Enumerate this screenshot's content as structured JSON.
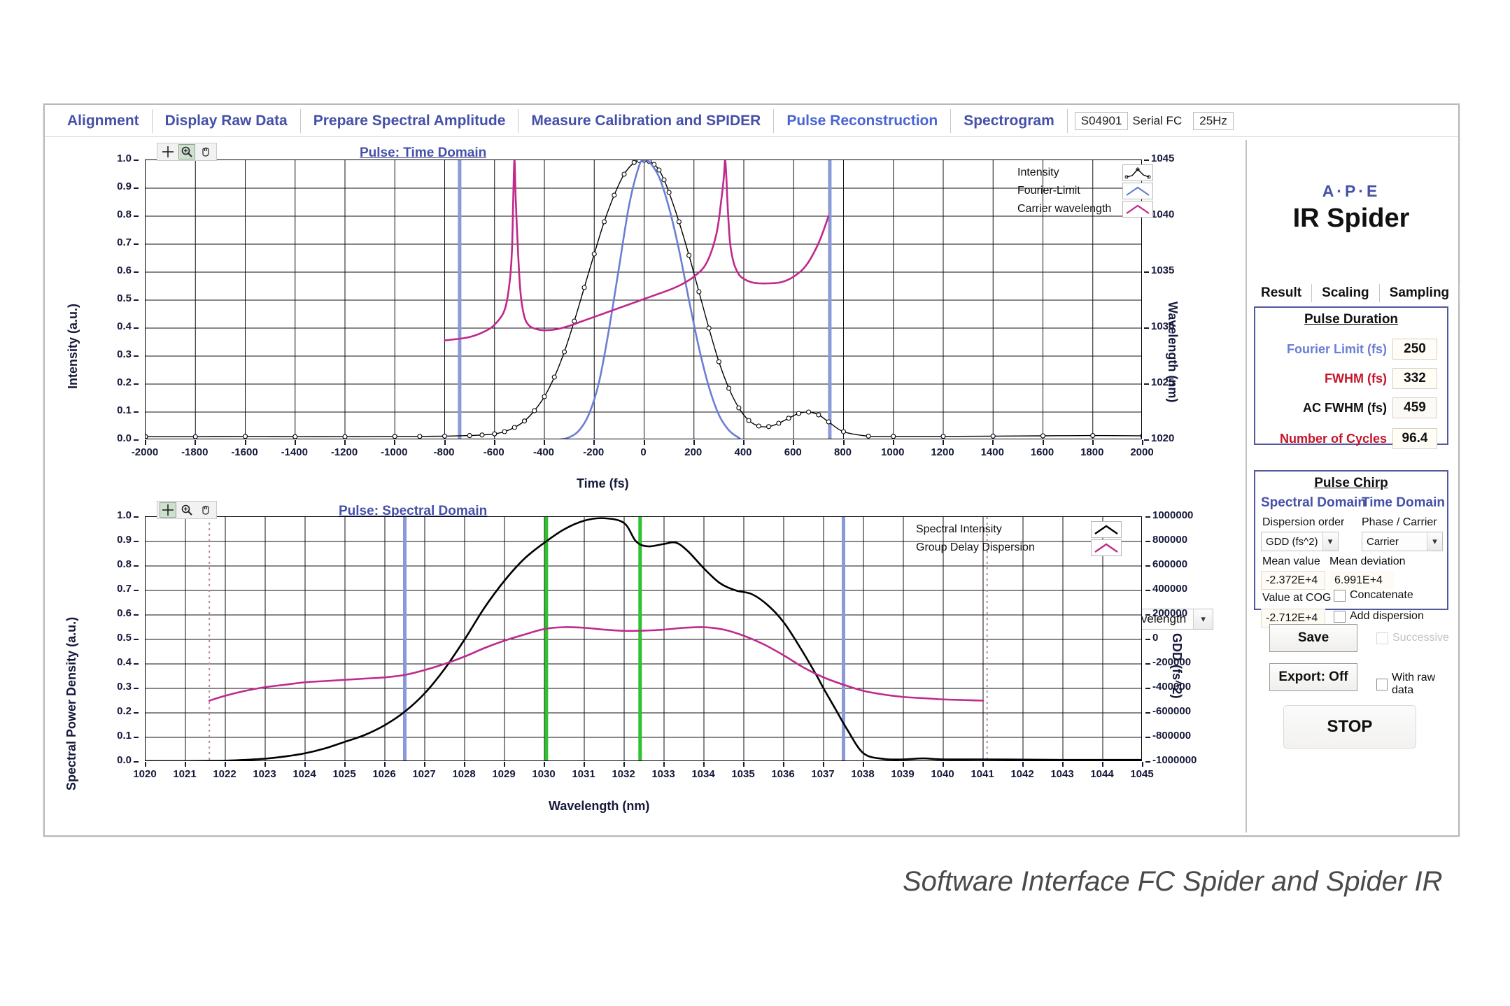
{
  "window": {
    "tabs": [
      {
        "label": "Alignment",
        "active": false
      },
      {
        "label": "Display Raw Data",
        "active": false
      },
      {
        "label": "Prepare Spectral Amplitude",
        "active": false
      },
      {
        "label": "Measure Calibration and SPIDER",
        "active": false
      },
      {
        "label": "Pulse Reconstruction",
        "active": true
      },
      {
        "label": "Spectrogram",
        "active": false
      }
    ],
    "serial_id": "S04901",
    "serial_label": "Serial FC",
    "rep_rate": "25Hz"
  },
  "top_plot": {
    "title": "Pulse: Time Domain",
    "xlabel": "Time (fs)",
    "ylabel": "Intensity (a.u.)",
    "y2label": "Wavelength (nm)",
    "legend": [
      {
        "label": "Intensity",
        "color": "#000000"
      },
      {
        "label": "Fourier-Limit",
        "color": "#6a7fd4"
      },
      {
        "label": "Carrier wavelength",
        "color": "#c0288c"
      }
    ],
    "toolbar": [
      "crosshair-tool",
      "zoom-tool",
      "pan-tool"
    ],
    "selector": {
      "value": "Wavelength"
    }
  },
  "bottom_plot": {
    "title": "Pulse: Spectral Domain",
    "xlabel": "Wavelength (nm)",
    "ylabel": "Spectral Power Density (a.u.)",
    "y2label": "GDD (fs^2)",
    "legend": [
      {
        "label": "Spectral Intensity",
        "color": "#000000"
      },
      {
        "label": "Group Delay Dispersion",
        "color": "#bf2a8e"
      }
    ],
    "toolbar": [
      "crosshair-tool",
      "zoom-tool",
      "pan-tool"
    ]
  },
  "panel": {
    "brand_top": "A·P·E",
    "brand_model": "IR Spider",
    "tabs": [
      {
        "label": "Result",
        "active": true
      },
      {
        "label": "Scaling",
        "active": false
      },
      {
        "label": "Sampling",
        "active": false
      }
    ],
    "pulse_duration": {
      "title": "Pulse Duration",
      "rows": [
        {
          "label": "Fourier Limit (fs)",
          "value": "250",
          "color": "#6a7fd4"
        },
        {
          "label": "FWHM (fs)",
          "value": "332",
          "color": "#c4152a"
        },
        {
          "label": "AC FWHM (fs)",
          "value": "459",
          "color": "#111111"
        },
        {
          "label": "Number of Cycles",
          "value": "96.4",
          "color": "#c4152a"
        }
      ]
    },
    "pulse_chirp": {
      "title": "Pulse Chirp",
      "spectral_domain_label": "Spectral Domain",
      "time_domain_label": "Time Domain",
      "dispersion_order_label": "Dispersion order",
      "dispersion_order_value": "GDD (fs^2)",
      "phase_carrier_label": "Phase / Carrier",
      "phase_carrier_value": "Carrier",
      "mean_value_label": "Mean value",
      "mean_value": "-2.372E+4",
      "mean_deviation_label": "Mean deviation",
      "mean_deviation": "6.991E+4",
      "value_at_cog_label": "Value at COG",
      "value_at_cog": "-2.712E+4",
      "concatenate_label": "Concatenate",
      "add_dispersion_label": "Add dispersion"
    },
    "actions": {
      "save_label": "Save",
      "successive_label": "Successive",
      "export_label": "Export: Off",
      "with_raw_data_label": "With raw data",
      "stop_label": "STOP"
    }
  },
  "caption": "Software Interface FC Spider and Spider IR",
  "chart_data": [
    {
      "type": "line",
      "title": "Pulse: Time Domain",
      "xlabel": "Time (fs)",
      "ylabel": "Intensity (a.u.)",
      "y2label": "Wavelength (nm)",
      "xlim": [
        -2000,
        2000
      ],
      "ylim": [
        0.0,
        1.0
      ],
      "y2lim": [
        1020,
        1045
      ],
      "xticks": [
        -2000,
        -1800,
        -1600,
        -1400,
        -1200,
        -1000,
        -800,
        -600,
        -400,
        -200,
        0,
        200,
        400,
        600,
        800,
        1000,
        1200,
        1400,
        1600,
        1800,
        2000
      ],
      "yticks": [
        0.0,
        0.1,
        0.2,
        0.3,
        0.4,
        0.5,
        0.6,
        0.7,
        0.8,
        0.9,
        1.0
      ],
      "y2ticks": [
        1020,
        1025,
        1030,
        1035,
        1040,
        1045
      ],
      "grid": true,
      "legend_position": "top-right",
      "cursors": [
        {
          "x": -740,
          "color": "#8a9ad8"
        },
        {
          "x": 745,
          "color": "#8a9ad8"
        }
      ],
      "series": [
        {
          "name": "Intensity",
          "color": "#000000",
          "markers": "circle",
          "x": [
            -2000,
            -1800,
            -1600,
            -1400,
            -1200,
            -1000,
            -900,
            -800,
            -700,
            -650,
            -600,
            -560,
            -520,
            -480,
            -440,
            -400,
            -360,
            -320,
            -280,
            -240,
            -200,
            -160,
            -120,
            -80,
            -40,
            -20,
            0,
            20,
            40,
            60,
            80,
            100,
            140,
            180,
            220,
            260,
            300,
            340,
            380,
            420,
            460,
            500,
            540,
            580,
            620,
            660,
            700,
            740,
            800,
            900,
            1000,
            1200,
            1400,
            1600,
            1800,
            2000
          ],
          "y": [
            0.012,
            0.012,
            0.013,
            0.012,
            0.012,
            0.013,
            0.013,
            0.014,
            0.016,
            0.018,
            0.022,
            0.03,
            0.045,
            0.068,
            0.105,
            0.155,
            0.225,
            0.315,
            0.425,
            0.545,
            0.665,
            0.78,
            0.875,
            0.95,
            0.992,
            0.999,
            1.0,
            0.996,
            0.985,
            0.965,
            0.93,
            0.885,
            0.78,
            0.66,
            0.53,
            0.4,
            0.28,
            0.185,
            0.115,
            0.07,
            0.05,
            0.048,
            0.06,
            0.078,
            0.095,
            0.1,
            0.09,
            0.065,
            0.03,
            0.014,
            0.013,
            0.013,
            0.014,
            0.015,
            0.016,
            0.015
          ]
        },
        {
          "name": "Fourier-Limit",
          "color": "#6a7fd4",
          "x": [
            -2000,
            -1000,
            -400,
            -340,
            -300,
            -260,
            -220,
            -180,
            -140,
            -100,
            -60,
            -20,
            0,
            20,
            60,
            100,
            140,
            180,
            220,
            260,
            300,
            340,
            380,
            400,
            500,
            800,
            1200,
            1600,
            2000
          ],
          "y": [
            0.0,
            0.0,
            0.0,
            0.002,
            0.01,
            0.035,
            0.095,
            0.21,
            0.4,
            0.62,
            0.84,
            0.98,
            1.0,
            0.995,
            0.94,
            0.83,
            0.68,
            0.5,
            0.33,
            0.19,
            0.09,
            0.035,
            0.008,
            0.0,
            0.0,
            0.0,
            0.0,
            0.0,
            0.0
          ]
        },
        {
          "name": "Carrier wavelength",
          "color": "#c0288c",
          "note": "plotted against right axis (nm); has two near-vertical asymptote spikes near -520 fs and +325 fs",
          "x_fs": [
            -800,
            -760,
            -700,
            -640,
            -600,
            -560,
            -540,
            -530,
            -525,
            -520,
            -515,
            -505,
            -495,
            -480,
            -460,
            -430,
            -400,
            -350,
            -300,
            -250,
            -200,
            -150,
            -100,
            -50,
            0,
            50,
            100,
            150,
            200,
            250,
            290,
            310,
            320,
            325,
            330,
            335,
            345,
            360,
            380,
            400,
            430,
            460,
            500,
            550,
            600,
            650,
            700,
            740
          ],
          "y_nm": [
            1028.9,
            1029.0,
            1029.2,
            1029.7,
            1030.3,
            1031.6,
            1034.0,
            1037.0,
            1041.5,
            1045.0,
            1041.5,
            1036.5,
            1033.0,
            1031.0,
            1030.2,
            1029.9,
            1029.8,
            1029.9,
            1030.2,
            1030.6,
            1031.0,
            1031.4,
            1031.8,
            1032.2,
            1032.6,
            1033.0,
            1033.4,
            1033.9,
            1034.6,
            1035.8,
            1038.4,
            1041.5,
            1043.5,
            1045.0,
            1043.5,
            1041.0,
            1037.6,
            1035.8,
            1034.8,
            1034.4,
            1034.1,
            1034.0,
            1034.0,
            1034.1,
            1034.6,
            1035.6,
            1037.6,
            1040.0
          ]
        }
      ]
    },
    {
      "type": "line",
      "title": "Pulse: Spectral Domain",
      "xlabel": "Wavelength (nm)",
      "ylabel": "Spectral Power Density (a.u.)",
      "y2label": "GDD (fs^2)",
      "xlim": [
        1020,
        1045
      ],
      "ylim": [
        0.0,
        1.0
      ],
      "y2lim": [
        -1000000,
        1000000
      ],
      "xticks": [
        1020,
        1021,
        1022,
        1023,
        1024,
        1025,
        1026,
        1027,
        1028,
        1029,
        1030,
        1031,
        1032,
        1033,
        1034,
        1035,
        1036,
        1037,
        1038,
        1039,
        1040,
        1041,
        1042,
        1043,
        1044,
        1045
      ],
      "yticks": [
        0.0,
        0.1,
        0.2,
        0.3,
        0.4,
        0.5,
        0.6,
        0.7,
        0.8,
        0.9,
        1.0
      ],
      "y2ticks": [
        -1000000,
        -800000,
        -600000,
        -400000,
        -200000,
        0,
        200000,
        400000,
        600000,
        800000,
        1000000
      ],
      "grid": true,
      "legend_position": "top-right",
      "cursors": [
        {
          "x": 1026.5,
          "color": "#8a9ad8"
        },
        {
          "x": 1037.5,
          "color": "#8a9ad8"
        },
        {
          "x": 1030.05,
          "color": "#2ec22e"
        },
        {
          "x": 1032.4,
          "color": "#2ec22e"
        },
        {
          "x": 1021.6,
          "color": "#b48aa8",
          "style": "dotted"
        },
        {
          "x": 1041.1,
          "color": "#b48aa8",
          "style": "dotted"
        }
      ],
      "series": [
        {
          "name": "Spectral Intensity",
          "color": "#000000",
          "x": [
            1020,
            1021,
            1021.6,
            1022,
            1022.5,
            1023,
            1023.5,
            1024,
            1024.5,
            1025,
            1025.5,
            1026,
            1026.5,
            1027,
            1027.5,
            1028,
            1028.5,
            1029,
            1029.5,
            1030,
            1030.5,
            1031,
            1031.5,
            1032,
            1032.3,
            1032.6,
            1033,
            1033.3,
            1033.6,
            1034,
            1034.4,
            1034.8,
            1035.2,
            1035.6,
            1036,
            1036.4,
            1036.8,
            1037,
            1037.3,
            1037.6,
            1038,
            1038.5,
            1039,
            1039.5,
            1040,
            1041,
            1042,
            1043,
            1044,
            1045
          ],
          "y": [
            0.003,
            0.003,
            0.004,
            0.005,
            0.008,
            0.013,
            0.022,
            0.035,
            0.055,
            0.082,
            0.11,
            0.15,
            0.205,
            0.28,
            0.38,
            0.5,
            0.63,
            0.74,
            0.83,
            0.895,
            0.95,
            0.985,
            0.995,
            0.975,
            0.9,
            0.88,
            0.89,
            0.895,
            0.86,
            0.79,
            0.73,
            0.7,
            0.685,
            0.64,
            0.57,
            0.47,
            0.36,
            0.3,
            0.215,
            0.13,
            0.035,
            0.012,
            0.01,
            0.014,
            0.01,
            0.01,
            0.009,
            0.008,
            0.008,
            0.008
          ]
        },
        {
          "name": "Group Delay Dispersion",
          "color": "#bf2a8e",
          "note": "values read on right GDD axis (fs^2)",
          "x": [
            1021.6,
            1022,
            1022.5,
            1023,
            1023.5,
            1024,
            1024.5,
            1025,
            1025.5,
            1026,
            1026.5,
            1027,
            1027.5,
            1028,
            1028.5,
            1029,
            1029.5,
            1030,
            1030.5,
            1031,
            1031.5,
            1032,
            1032.5,
            1033,
            1033.5,
            1034,
            1034.5,
            1035,
            1035.5,
            1036,
            1036.5,
            1037,
            1037.5,
            1038,
            1038.5,
            1039,
            1039.5,
            1040,
            1040.5,
            1041
          ],
          "y_gdd": [
            -500000,
            -460000,
            -420000,
            -390000,
            -370000,
            -350000,
            -340000,
            -330000,
            -320000,
            -310000,
            -290000,
            -250000,
            -200000,
            -140000,
            -70000,
            -10000,
            40000,
            85000,
            100000,
            95000,
            80000,
            70000,
            72000,
            80000,
            95000,
            100000,
            80000,
            30000,
            -40000,
            -130000,
            -230000,
            -310000,
            -370000,
            -420000,
            -450000,
            -470000,
            -480000,
            -490000,
            -495000,
            -500000
          ]
        }
      ]
    }
  ]
}
